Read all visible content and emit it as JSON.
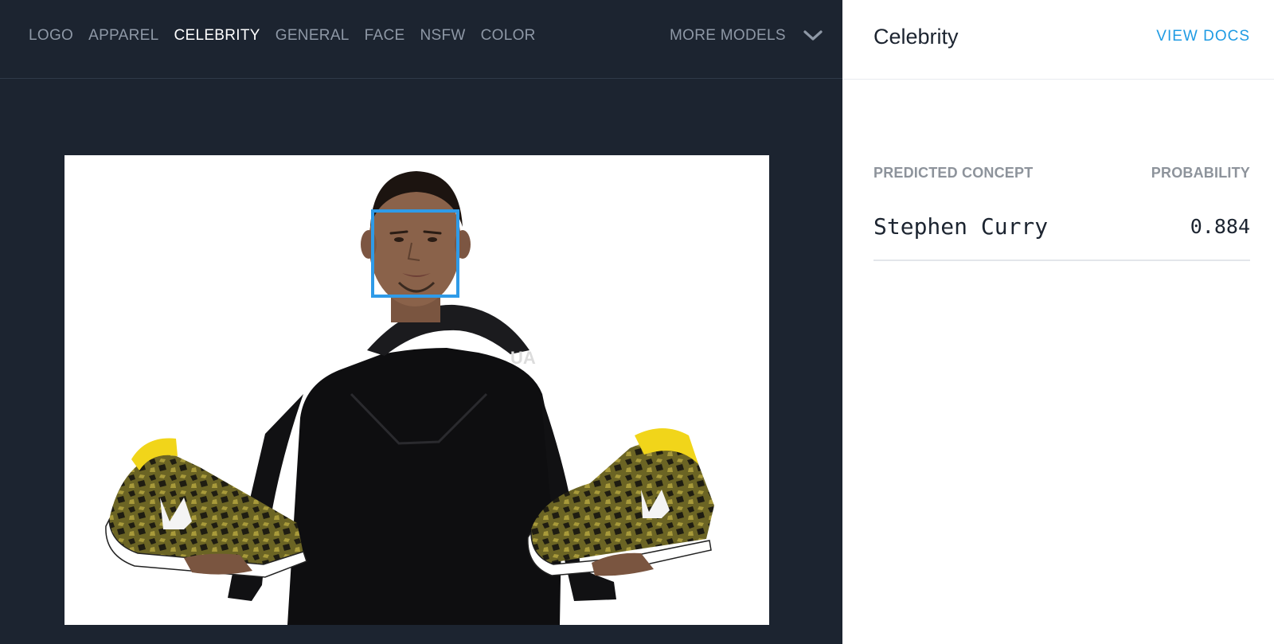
{
  "nav": {
    "tabs": [
      {
        "label": "LOGO",
        "active": false
      },
      {
        "label": "APPAREL",
        "active": false
      },
      {
        "label": "CELEBRITY",
        "active": true
      },
      {
        "label": "GENERAL",
        "active": false
      },
      {
        "label": "FACE",
        "active": false
      },
      {
        "label": "NSFW",
        "active": false
      },
      {
        "label": "COLOR",
        "active": false
      }
    ],
    "more_models_label": "MORE MODELS",
    "more_models_icon": "chevron-down-icon"
  },
  "panel": {
    "title": "Celebrity",
    "view_docs_label": "VIEW DOCS",
    "columns": {
      "concept": "PREDICTED CONCEPT",
      "probability": "PROBABILITY"
    },
    "results": [
      {
        "concept": "Stephen Curry",
        "probability": "0.884"
      }
    ]
  },
  "colors": {
    "nav_background": "#1c2430",
    "active_tab": "#ffffff",
    "inactive_tab": "#8e98a6",
    "accent": "#1f9be3",
    "face_box": "#2f9be8"
  }
}
